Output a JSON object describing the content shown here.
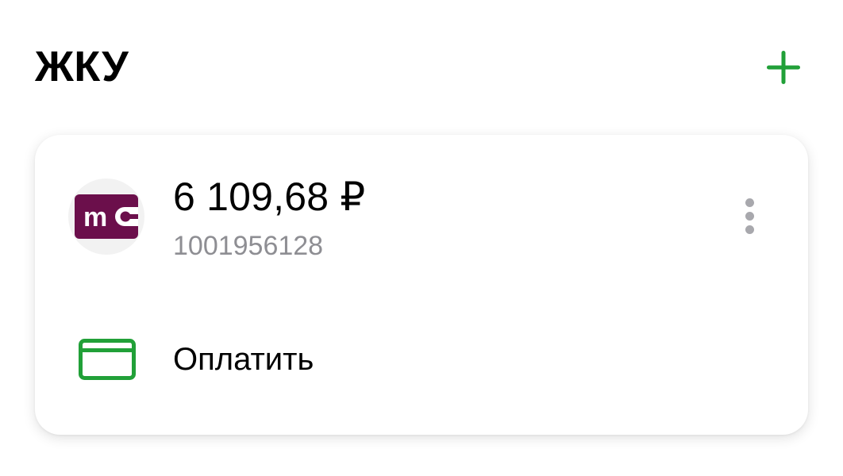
{
  "section": {
    "title": "ЖКУ",
    "add_icon": "plus-icon"
  },
  "card": {
    "provider_logo_text": "m",
    "provider_logo_icon": "wallet-logo-icon",
    "amount": "6 109,68 ₽",
    "account_number": "1001956128",
    "more_icon": "more-vertical-icon",
    "pay": {
      "label": "Оплатить",
      "icon": "card-icon"
    }
  },
  "colors": {
    "accent_green": "#21A038",
    "logo_purple": "#6B0F4B",
    "secondary_text": "#8E8E93"
  }
}
